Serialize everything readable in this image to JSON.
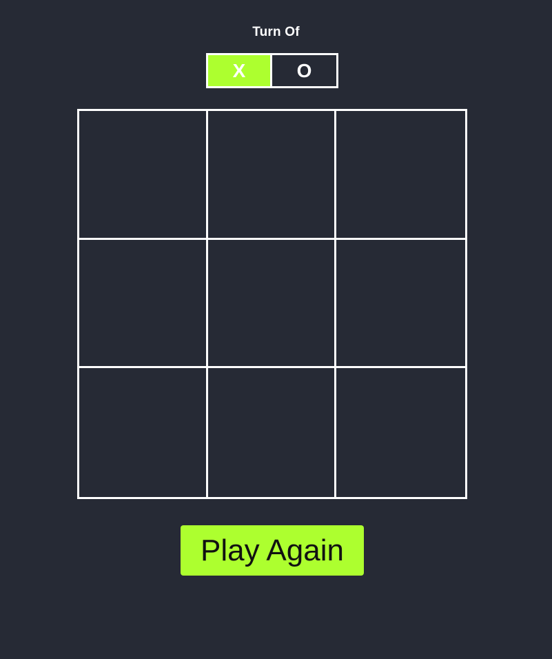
{
  "header": {
    "turn_label": "Turn Of"
  },
  "turn": {
    "options": [
      "X",
      "O"
    ],
    "active": "X"
  },
  "board": {
    "cells": [
      "",
      "",
      "",
      "",
      "",
      "",
      "",
      "",
      ""
    ]
  },
  "controls": {
    "play_again_label": "Play Again"
  },
  "colors": {
    "background": "#262a35",
    "accent": "#adff2f",
    "grid_lines": "#ffffff",
    "text": "#ffffff"
  }
}
